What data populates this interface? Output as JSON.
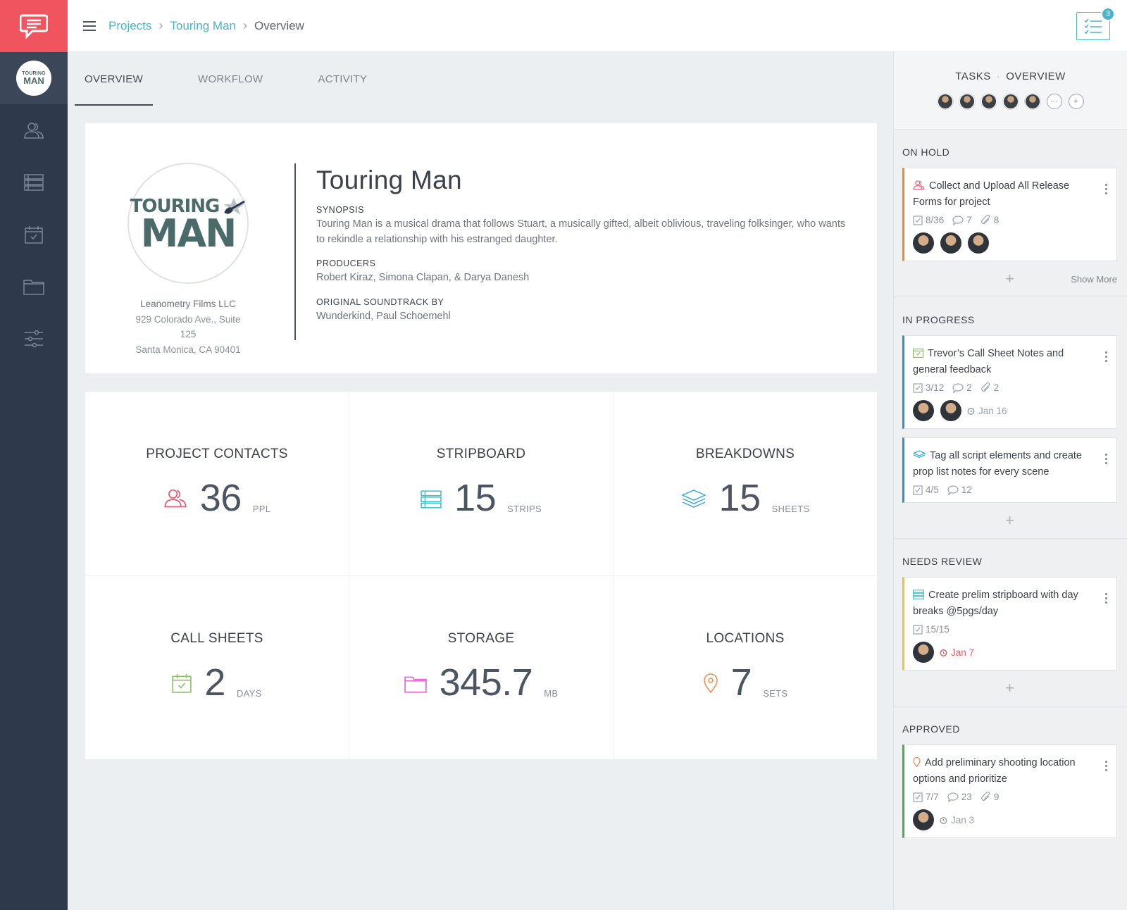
{
  "rail": {
    "project_badge": {
      "line1": "TOURING",
      "line2": "MAN"
    },
    "icons": [
      "contacts-icon",
      "stripboard-icon",
      "calendar-icon",
      "folder-icon",
      "settings-sliders-icon"
    ]
  },
  "breadcrumb": {
    "projects": "Projects",
    "project": "Touring Man",
    "current": "Overview"
  },
  "tasks_button": {
    "badge": "3"
  },
  "tabs": [
    {
      "label": "OVERVIEW",
      "active": true
    },
    {
      "label": "WORKFLOW",
      "active": false
    },
    {
      "label": "ACTIVITY",
      "active": false
    }
  ],
  "project": {
    "poster": {
      "line1": "TOURING",
      "line2": "MAN"
    },
    "company": "Leanometry Films LLC",
    "address1": "929 Colorado Ave., Suite 125",
    "address2": "Santa Monica, CA 90401",
    "title": "Touring Man",
    "synopsis_label": "SYNOPSIS",
    "synopsis": "Touring Man is a musical drama that follows Stuart, a musically gifted, albeit oblivious, traveling folksinger, who wants to rekindle a relationship with his estranged daughter.",
    "producers_label": "PRODUCERS",
    "producers": "Robert Kiraz, Simona Clapan, & Darya Danesh",
    "soundtrack_label": "ORIGINAL SOUNDTRACK BY",
    "soundtrack": "Wunderkind, Paul Schoemehl"
  },
  "stats": [
    {
      "title": "PROJECT CONTACTS",
      "value": "36",
      "unit": "PPL",
      "icon": "contacts-icon",
      "color": "#f0546f"
    },
    {
      "title": "STRIPBOARD",
      "value": "15",
      "unit": "STRIPS",
      "icon": "stripboard-icon",
      "color": "#45c3c6"
    },
    {
      "title": "BREAKDOWNS",
      "value": "15",
      "unit": "SHEETS",
      "icon": "layers-icon",
      "color": "#3aa9d6"
    },
    {
      "title": "CALL SHEETS",
      "value": "2",
      "unit": "DAYS",
      "icon": "calendar-icon",
      "color": "#8fbf6b"
    },
    {
      "title": "STORAGE",
      "value": "345.7",
      "unit": "MB",
      "icon": "folder-icon",
      "color": "#e85fd0"
    },
    {
      "title": "LOCATIONS",
      "value": "7",
      "unit": "SETS",
      "icon": "location-pin-icon",
      "color": "#f08a4b"
    }
  ],
  "panel": {
    "tasks_label": "TASKS",
    "overview_label": "OVERVIEW",
    "sections": {
      "on_hold": {
        "label": "ON HOLD",
        "show_more": "Show More",
        "color": "#f5882b",
        "task": {
          "title": "Collect and Upload All Release Forms for project",
          "checks": "8/36",
          "comments": "7",
          "attachments": "8"
        }
      },
      "in_progress": {
        "label": "IN PROGRESS",
        "color": "#2b8fd3",
        "task1": {
          "title": "Trevor’s Call Sheet Notes and general feedback",
          "checks": "3/12",
          "comments": "2",
          "attachments": "2",
          "due": "Jan 16"
        },
        "task2": {
          "title": "Tag all script elements and create prop list notes for every scene",
          "checks": "4/5",
          "comments": "12"
        }
      },
      "needs_review": {
        "label": "NEEDS REVIEW",
        "color": "#f4c430",
        "task": {
          "title": "Create prelim stripboard with day breaks @5pgs/day",
          "checks": "15/15",
          "due": "Jan 7"
        }
      },
      "approved": {
        "label": "APPROVED",
        "color": "#3cb54a",
        "task": {
          "title": "Add preliminary shooting location options and prioritize",
          "checks": "7/7",
          "comments": "23",
          "attachments": "9",
          "due": "Jan 3"
        }
      }
    }
  }
}
